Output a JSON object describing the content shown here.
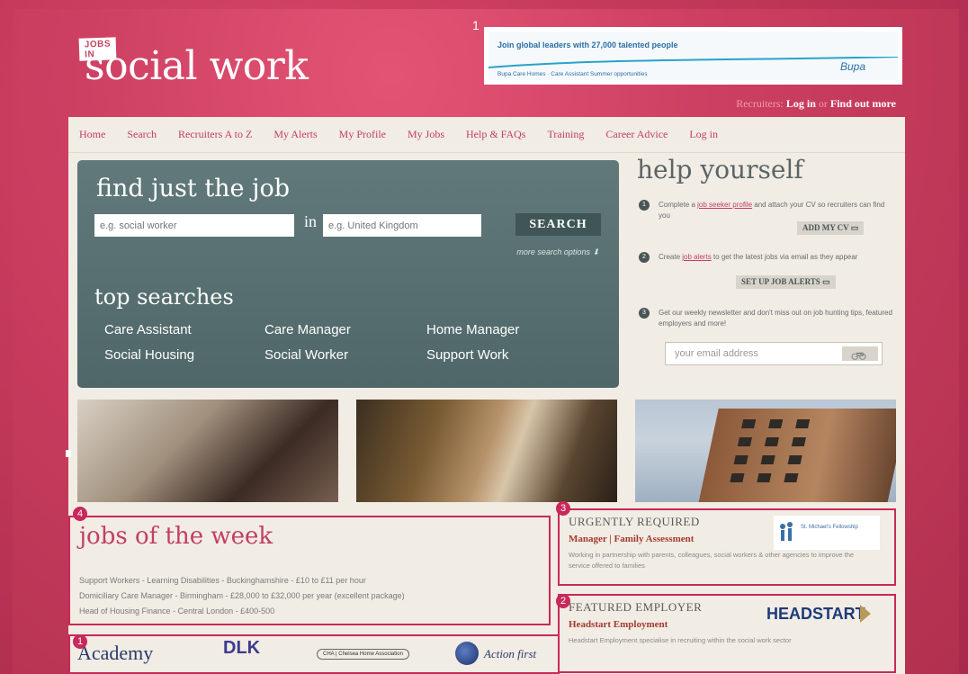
{
  "header": {
    "logo_tag": "JOBS IN",
    "logo_main": "social work",
    "recruiters_label": "Recruiters:",
    "login": "Log in",
    "or": "or",
    "find_out_more": "Find out more"
  },
  "ad": {
    "number": "1",
    "headline": "Join global leaders with 27,000 talented people",
    "sub": "Bupa Care Homes · Care Assistant Summer opportunities",
    "brand": "Bupa"
  },
  "nav": [
    "Home",
    "Search",
    "Recruiters A to Z",
    "My Alerts",
    "My Profile",
    "My Jobs",
    "Help & FAQs",
    "Training",
    "Career Advice",
    "Log in"
  ],
  "search": {
    "title": "find just the job",
    "keyword_placeholder": "e.g. social worker",
    "in_label": "in",
    "location_placeholder": "e.g. United Kingdom",
    "button": "SEARCH",
    "more_options": "more search options ⬇"
  },
  "top_searches": {
    "title": "top searches",
    "items": [
      "Care Assistant",
      "Care Manager",
      "Home Manager",
      "Social Housing",
      "Social Worker",
      "Support Work"
    ]
  },
  "help": {
    "title": "help yourself",
    "step1_pre": "Complete a ",
    "step1_link": "job seeker profile",
    "step1_post": " and attach your CV so recruiters can find you",
    "step1_button": "ADD MY CV",
    "step2_pre": "Create ",
    "step2_link": "job alerts",
    "step2_post": " to get the latest jobs via email as they appear",
    "step2_button": "SET UP JOB ALERTS",
    "step3_text": "Get our weekly newsletter and don't miss out on job hunting tips, featured employers and more!",
    "email_placeholder": "your email address",
    "go_button": "GO"
  },
  "jobs_of_week": {
    "number": "4",
    "title": "jobs of the week",
    "items": [
      "Support Workers - Learning Disabilities - Buckinghamshire - £10 to £11 per hour",
      "Domiciliary Care Manager - Birmingham - £28,000 to £32,000 per year (excellent package)",
      "Head of Housing Finance - Central London - £400-500"
    ]
  },
  "urgently": {
    "number": "3",
    "heading": "URGENTLY REQUIRED",
    "subheading": "Manager | Family Assessment",
    "body": "Working in partnership with parents, colleagues, social workers & other agencies to improve the service offered to families",
    "logo_text": "St. Michael's Fellowship"
  },
  "featured": {
    "number": "2",
    "heading": "FEATURED EMPLOYER",
    "subheading": "Headstart Employment",
    "body": "Headstart Employment specialise in recruiting within the social work sector",
    "logo_text": "HEADSTART"
  },
  "logos_strip": {
    "number": "1",
    "academy": "Academy",
    "dlk": "DLK",
    "cha": "CHA | Chelsea Home Association",
    "action_first": "Action first"
  }
}
